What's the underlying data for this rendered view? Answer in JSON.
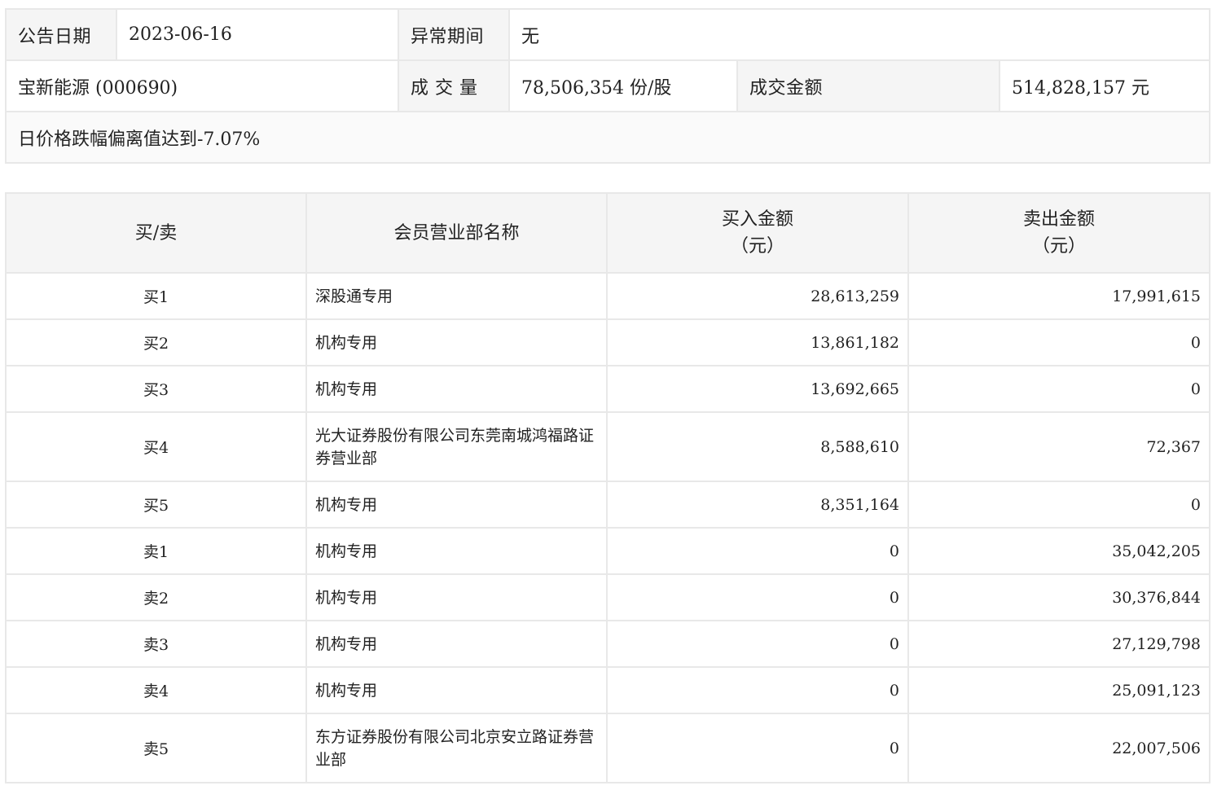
{
  "info": {
    "announce_date_label": "公告日期",
    "announce_date": "2023-06-16",
    "abnormal_period_label": "异常期间",
    "abnormal_period": "无",
    "stock": "宝新能源 (000690)",
    "volume_label": "成 交 量",
    "volume": "78,506,354 份/股",
    "turnover_label": "成交金额",
    "turnover": "514,828,157 元",
    "reason": "日价格跌幅偏离值达到-7.07%"
  },
  "table": {
    "headers": {
      "side": "买/卖",
      "member": "会员营业部名称",
      "buy_line1": "买入金额",
      "buy_line2": "（元）",
      "sell_line1": "卖出金额",
      "sell_line2": "（元）"
    },
    "rows": [
      {
        "side": "买1",
        "member": "深股通专用",
        "buy": "28,613,259",
        "sell": "17,991,615"
      },
      {
        "side": "买2",
        "member": "机构专用",
        "buy": "13,861,182",
        "sell": "0"
      },
      {
        "side": "买3",
        "member": "机构专用",
        "buy": "13,692,665",
        "sell": "0"
      },
      {
        "side": "买4",
        "member": "光大证券股份有限公司东莞南城鸿福路证券营业部",
        "buy": "8,588,610",
        "sell": "72,367"
      },
      {
        "side": "买5",
        "member": "机构专用",
        "buy": "8,351,164",
        "sell": "0"
      },
      {
        "side": "卖1",
        "member": "机构专用",
        "buy": "0",
        "sell": "35,042,205"
      },
      {
        "side": "卖2",
        "member": "机构专用",
        "buy": "0",
        "sell": "30,376,844"
      },
      {
        "side": "卖3",
        "member": "机构专用",
        "buy": "0",
        "sell": "27,129,798"
      },
      {
        "side": "卖4",
        "member": "机构专用",
        "buy": "0",
        "sell": "25,091,123"
      },
      {
        "side": "卖5",
        "member": "东方证券股份有限公司北京安立路证券营业部",
        "buy": "0",
        "sell": "22,007,506"
      }
    ]
  }
}
